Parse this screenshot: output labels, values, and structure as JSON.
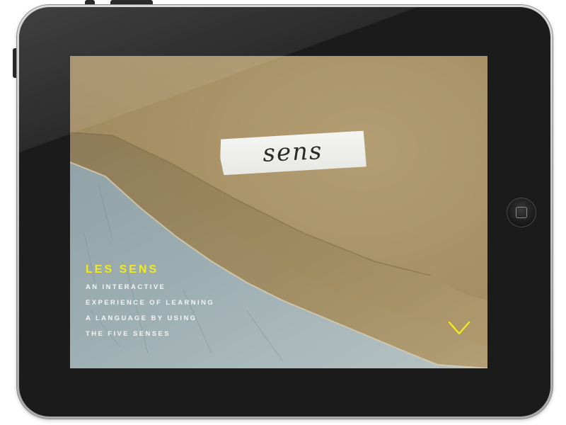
{
  "app": {
    "tape_label": "sens",
    "title": "LES SENS",
    "subtitle_lines": [
      "AN INTERACTIVE",
      "EXPERIENCE OF LEARNING",
      "A LANGUAGE BY USING",
      "THE FIVE SENSES"
    ],
    "accent_color": "#f2ea1c"
  },
  "icons": {
    "scroll": "chevron-down-icon",
    "home": "home-button-icon"
  }
}
